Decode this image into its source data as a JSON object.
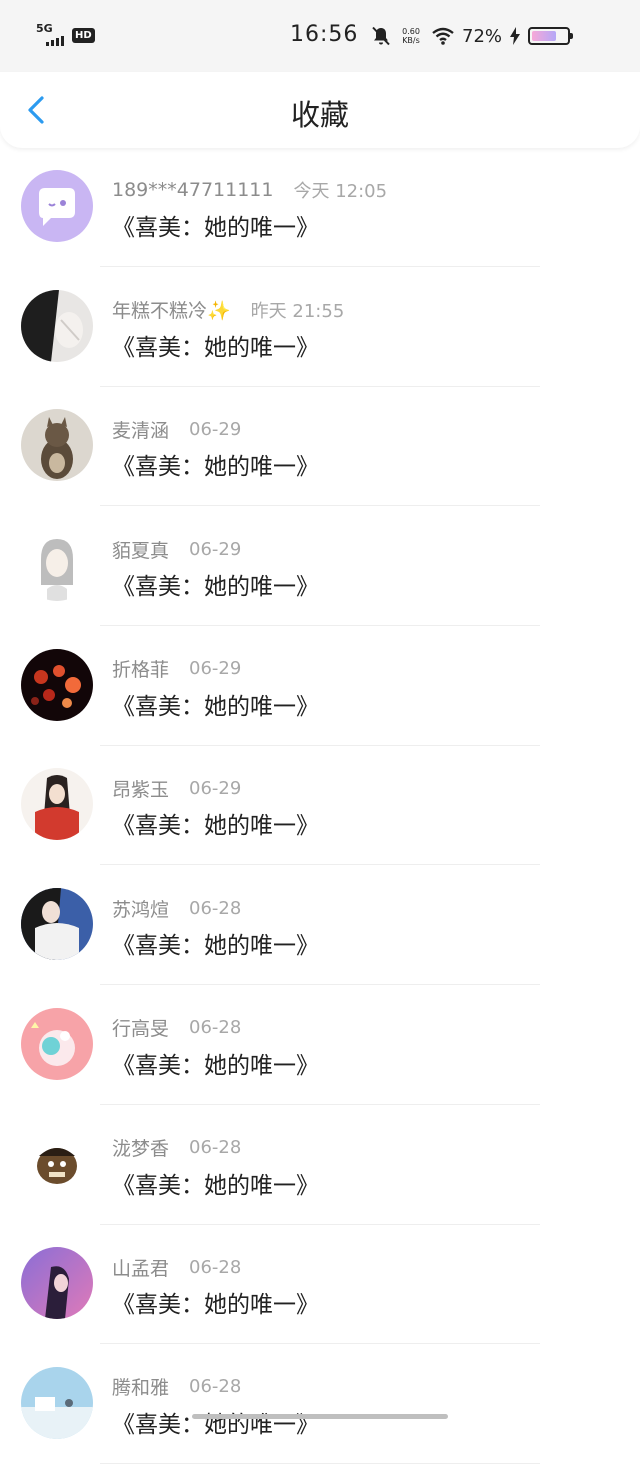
{
  "status_bar": {
    "network": "5G",
    "hd_badge": "HD",
    "time": "16:56",
    "speed_value": "0.60",
    "speed_unit": "KB/s",
    "battery_percent": "72%",
    "battery_level": 0.72
  },
  "header": {
    "back_icon": "chevron-left-icon",
    "title": "收藏"
  },
  "items": [
    {
      "name": "189***47711111",
      "time": "今天 12:05",
      "title": "《喜美：她的唯一》"
    },
    {
      "name": "年糕不糕冷✨",
      "time": "昨天 21:55",
      "title": "《喜美：她的唯一》"
    },
    {
      "name": "麦清涵",
      "time": "06-29",
      "title": "《喜美：她的唯一》"
    },
    {
      "name": "貊夏真",
      "time": "06-29",
      "title": "《喜美：她的唯一》"
    },
    {
      "name": "折格菲",
      "time": "06-29",
      "title": "《喜美：她的唯一》"
    },
    {
      "name": "昂紫玉",
      "time": "06-29",
      "title": "《喜美：她的唯一》"
    },
    {
      "name": "苏鸿煊",
      "time": "06-28",
      "title": "《喜美：她的唯一》"
    },
    {
      "name": "行高旻",
      "time": "06-28",
      "title": "《喜美：她的唯一》"
    },
    {
      "name": "泷梦香",
      "time": "06-28",
      "title": "《喜美：她的唯一》"
    },
    {
      "name": "山孟君",
      "time": "06-28",
      "title": "《喜美：她的唯一》"
    },
    {
      "name": "腾和雅",
      "time": "06-28",
      "title": "《喜美：她的唯一》"
    }
  ],
  "colors": {
    "accent": "#2c9bf0",
    "name_text": "#8c8c8c",
    "time_text": "#a8a8a8",
    "title_text": "#222222"
  }
}
